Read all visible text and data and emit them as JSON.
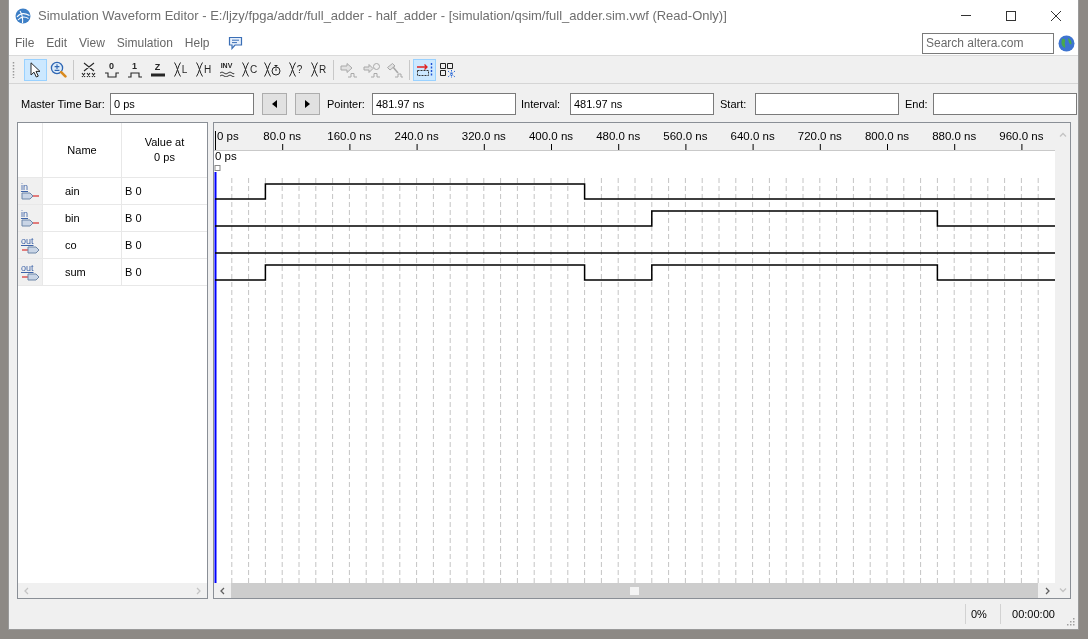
{
  "window": {
    "title": "Simulation Waveform Editor - E:/ljzy/fpga/addr/full_adder - half_adder - [simulation/qsim/full_adder.sim.vwf (Read-Only)]"
  },
  "menu": [
    "File",
    "Edit",
    "View",
    "Simulation",
    "Help"
  ],
  "search": {
    "placeholder": "Search altera.com"
  },
  "toolbar": {
    "groups": [
      [
        {
          "kind": "pointer",
          "selected": true,
          "disabled": false
        },
        {
          "kind": "zoom",
          "selected": false,
          "disabled": false
        }
      ],
      [
        {
          "kind": "unknown",
          "selected": false,
          "disabled": false
        },
        {
          "kind": "low",
          "label": "0",
          "selected": false,
          "disabled": false
        },
        {
          "kind": "high",
          "label": "1",
          "selected": false,
          "disabled": false
        },
        {
          "kind": "high_impedance",
          "label": "Z",
          "selected": false,
          "disabled": false
        },
        {
          "kind": "crossing",
          "label": "L",
          "selected": false,
          "disabled": false
        },
        {
          "kind": "crossing",
          "label": "H",
          "selected": false,
          "disabled": false
        },
        {
          "kind": "invert",
          "label": "INV",
          "selected": false,
          "disabled": false
        },
        {
          "kind": "crossing",
          "label": "C",
          "selected": false,
          "disabled": false
        },
        {
          "kind": "clock",
          "selected": false,
          "disabled": false
        },
        {
          "kind": "crossing",
          "label": "?",
          "selected": false,
          "disabled": false
        },
        {
          "kind": "crossing",
          "label": "R",
          "selected": false,
          "disabled": false
        }
      ],
      [
        {
          "kind": "run_functional",
          "selected": false,
          "disabled": true
        },
        {
          "kind": "run_timing",
          "selected": false,
          "disabled": true
        },
        {
          "kind": "netlist",
          "selected": false,
          "disabled": true
        }
      ],
      [
        {
          "kind": "snap",
          "selected": true,
          "disabled": false
        },
        {
          "kind": "grid",
          "selected": false,
          "disabled": false
        }
      ]
    ]
  },
  "time_bar": {
    "fields": [
      {
        "label": "Master Time Bar:",
        "value": "0 ps"
      },
      {
        "label": "Pointer:",
        "value": "481.97 ns"
      },
      {
        "label": "Interval:",
        "value": "481.97 ns"
      },
      {
        "label": "Start:"
      },
      {
        "label": "End:"
      }
    ]
  },
  "signals": {
    "columns": [
      "Name",
      "Value at 0 ps"
    ],
    "rows": [
      {
        "kind": "input",
        "pin": "in",
        "name": "ain",
        "value": "B 0"
      },
      {
        "kind": "input",
        "pin": "in",
        "name": "bin",
        "value": "B 0"
      },
      {
        "kind": "output",
        "pin": "out",
        "name": "co",
        "value": "B 0"
      },
      {
        "kind": "output",
        "pin": "out",
        "name": "sum",
        "value": "B 0"
      }
    ]
  },
  "waveform": {
    "ruler": [
      "0 ps",
      "80.0 ns",
      "160.0 ns",
      "240.0 ns",
      "320.0 ns",
      "400.0 ns",
      "480.0 ns",
      "560.0 ns",
      "640.0 ns",
      "720.0 ns",
      "800.0 ns",
      "880.0 ns",
      "960.0 ns"
    ],
    "marker": "0 ps"
  },
  "status_bar": {
    "progress": "0%",
    "elapsed": "00:00:00"
  }
}
